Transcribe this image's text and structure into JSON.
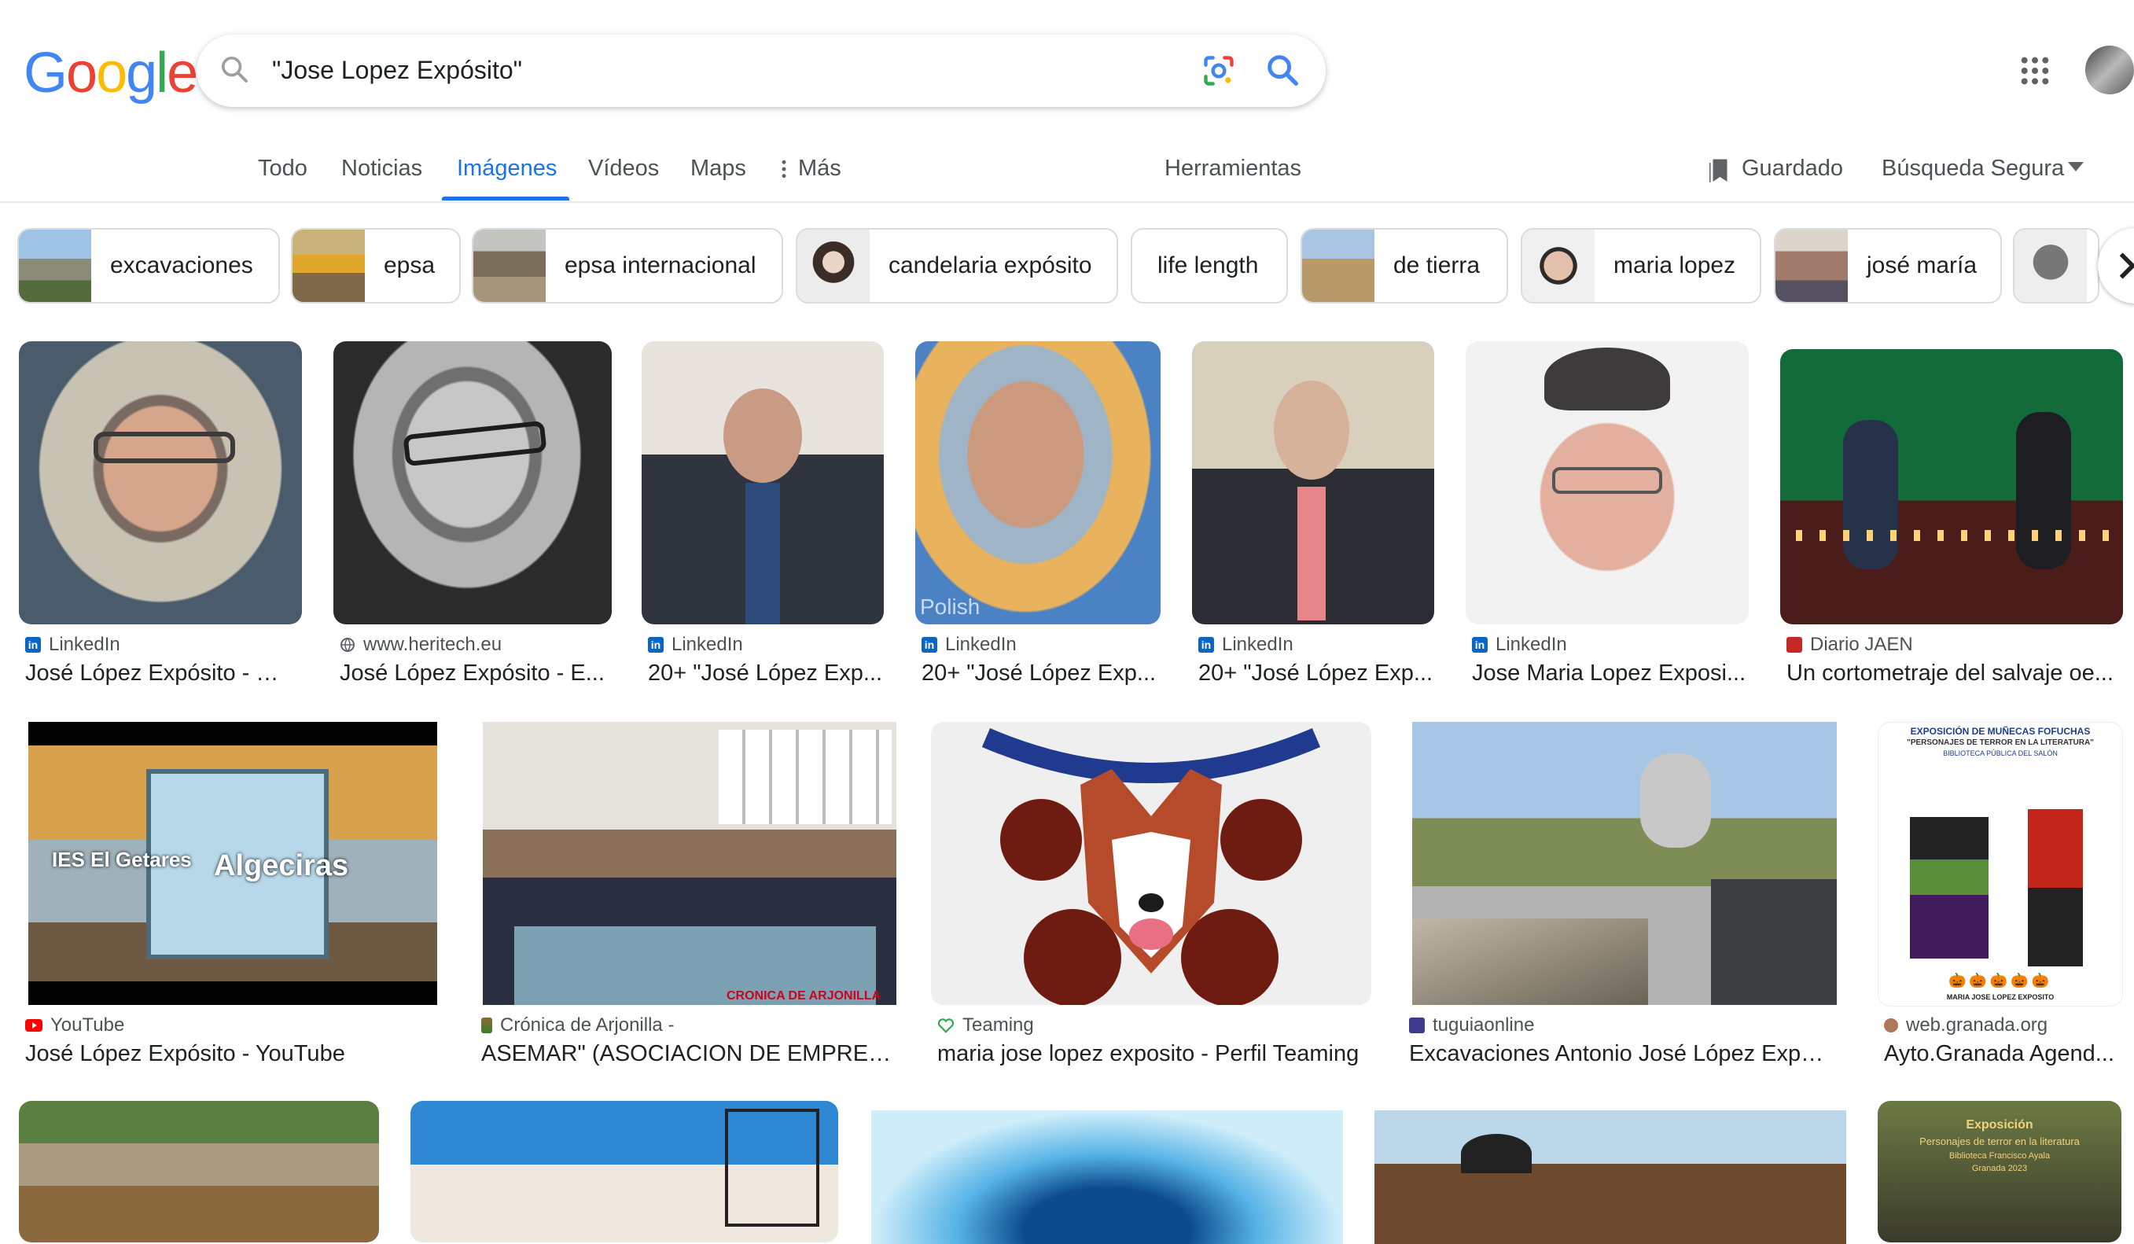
{
  "search": {
    "query": "\"Jose Lopez Expósito\""
  },
  "tabs": [
    {
      "label": "Todo"
    },
    {
      "label": "Noticias"
    },
    {
      "label": "Imágenes"
    },
    {
      "label": "Vídeos"
    },
    {
      "label": "Maps"
    },
    {
      "label": "Más"
    }
  ],
  "toolbar": {
    "tools": "Herramientas",
    "saved": "Guardado",
    "safesearch": "Búsqueda Segura"
  },
  "chips": [
    {
      "label": "excavaciones"
    },
    {
      "label": "epsa"
    },
    {
      "label": "epsa internacional"
    },
    {
      "label": "candelaria expósito"
    },
    {
      "label": "life length"
    },
    {
      "label": "de tierra"
    },
    {
      "label": "maria lopez"
    },
    {
      "label": "josé maría"
    }
  ],
  "results": [
    {
      "source": "LinkedIn",
      "title": "José López Expósito - Pr..."
    },
    {
      "source": "www.heritech.eu",
      "title": "José López Expósito - E..."
    },
    {
      "source": "LinkedIn",
      "title": "20+ \"José López Exp..."
    },
    {
      "source": "LinkedIn",
      "title": "20+ \"José López Exp..."
    },
    {
      "source": "LinkedIn",
      "title": "20+ \"José López Exp..."
    },
    {
      "source": "LinkedIn",
      "title": "Jose Maria Lopez Exposi..."
    },
    {
      "source": "Diario JAEN",
      "title": "Un cortometraje del salvaje oe..."
    },
    {
      "source": "YouTube",
      "title": "José López Expósito - YouTube"
    },
    {
      "source": "Crónica de Arjonilla -",
      "title": "ASEMAR\" (ASOCIACION DE EMPRESAR..."
    },
    {
      "source": "Teaming",
      "title": "maria jose lopez exposito - Perfil Teaming"
    },
    {
      "source": "tuguiaonline",
      "title": "Excavaciones Antonio José López Expós..."
    },
    {
      "source": "web.granada.org",
      "title": "Ayto.Granada Agend..."
    }
  ],
  "image_texts": {
    "ies": "IES El Getares",
    "algeciras": "Algeciras",
    "polish": "Polish",
    "cronica": "CRONICA DE ARJONILLA",
    "expo_title": "EXPOSICIÓN DE MUÑECAS FOFUCHAS",
    "expo_sub": "\"PERSONAJES DE TERROR EN LA LITERATURA\"",
    "expo_lib": "BIBLIOTECA PÚBLICA DEL SALÓN",
    "expo_author": "MARIA JOSE LOPEZ EXPOSITO",
    "expo2_a": "Exposición",
    "expo2_b": "Personajes de terror en la literatura",
    "expo2_c": "Biblioteca Francisco Ayala",
    "expo2_d": "Granada 2023"
  },
  "colors": {
    "accent": "#1a73e8",
    "linkedin": "#0a66c2",
    "youtube": "#ff0000"
  },
  "icons": [
    "search-icon",
    "google-lens-icon",
    "apps-grid-icon",
    "bookmark-icon",
    "chevron-right-icon",
    "more-vert-icon"
  ]
}
